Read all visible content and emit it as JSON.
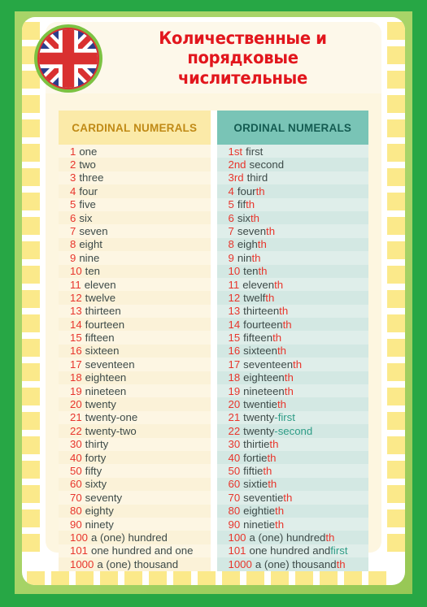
{
  "poster": {
    "title_line1": "Количественные и порядковые",
    "title_line2": "числительные",
    "emblem": "uk-flag-circle"
  },
  "table": {
    "headers": {
      "cardinal": "CARDINAL NUMERALS",
      "ordinal": "ORDINAL NUMERALS"
    },
    "colors": {
      "number_red": "#e8352c",
      "word_dark": "#3d4a48",
      "suffix_red": "#e8352c",
      "suffix_teal": "#2e9c86",
      "cardinal_header_bg": "#fbeaa8",
      "cardinal_header_text": "#c08a16",
      "ordinal_header_bg": "#79c4b6",
      "ordinal_header_text": "#145c52",
      "title_red": "#e2161d",
      "frame_green": "#27a745",
      "frame_light_green": "#a8d468",
      "tile_yellow": "#fbe98a"
    },
    "cardinal": [
      {
        "num": "1",
        "word": "one"
      },
      {
        "num": "2",
        "word": "two"
      },
      {
        "num": "3",
        "word": "three"
      },
      {
        "num": "4",
        "word": "four"
      },
      {
        "num": "5",
        "word": "five"
      },
      {
        "num": "6",
        "word": "six"
      },
      {
        "num": "7",
        "word": "seven"
      },
      {
        "num": "8",
        "word": "eight"
      },
      {
        "num": "9",
        "word": "nine"
      },
      {
        "num": "10",
        "word": "ten"
      },
      {
        "num": "11",
        "word": "eleven"
      },
      {
        "num": "12",
        "word": "twelve"
      },
      {
        "num": "13",
        "word": "thirteen"
      },
      {
        "num": "14",
        "word": "fourteen"
      },
      {
        "num": "15",
        "word": "fifteen"
      },
      {
        "num": "16",
        "word": "sixteen"
      },
      {
        "num": "17",
        "word": "seventeen"
      },
      {
        "num": "18",
        "word": "eighteen"
      },
      {
        "num": "19",
        "word": "nineteen"
      },
      {
        "num": "20",
        "word": "twenty"
      },
      {
        "num": "21",
        "word": "twenty-one"
      },
      {
        "num": "22",
        "word": "twenty-two"
      },
      {
        "num": "30",
        "word": "thirty"
      },
      {
        "num": "40",
        "word": "forty"
      },
      {
        "num": "50",
        "word": "fifty"
      },
      {
        "num": "60",
        "word": "sixty"
      },
      {
        "num": "70",
        "word": "seventy"
      },
      {
        "num": "80",
        "word": "eighty"
      },
      {
        "num": "90",
        "word": "ninety"
      },
      {
        "num": "100",
        "word": "a (one) hundred"
      },
      {
        "num": "101",
        "word": "one hundred and one"
      },
      {
        "num": "1000",
        "word": "a (one) thousand"
      }
    ],
    "ordinal": [
      {
        "num": "1st",
        "stem": "first",
        "suffix": "",
        "suffix_color": "red"
      },
      {
        "num": "2nd",
        "stem": "second",
        "suffix": "",
        "suffix_color": "red"
      },
      {
        "num": "3rd",
        "stem": "third",
        "suffix": "",
        "suffix_color": "red"
      },
      {
        "num": "4",
        "stem": "four",
        "suffix": "th",
        "suffix_color": "red"
      },
      {
        "num": "5",
        "stem": "fif",
        "suffix": "th",
        "suffix_color": "red"
      },
      {
        "num": "6",
        "stem": "six",
        "suffix": "th",
        "suffix_color": "red"
      },
      {
        "num": "7",
        "stem": "seven",
        "suffix": "th",
        "suffix_color": "red"
      },
      {
        "num": "8",
        "stem": "eigh",
        "suffix": "th",
        "suffix_color": "red"
      },
      {
        "num": "9",
        "stem": "nin",
        "suffix": "th",
        "suffix_color": "red"
      },
      {
        "num": "10",
        "stem": "ten",
        "suffix": "th",
        "suffix_color": "red"
      },
      {
        "num": "11",
        "stem": "eleven",
        "suffix": "th",
        "suffix_color": "red"
      },
      {
        "num": "12",
        "stem": "twelf",
        "suffix": "th",
        "suffix_color": "red"
      },
      {
        "num": "13",
        "stem": "thirteen",
        "suffix": "th",
        "suffix_color": "red"
      },
      {
        "num": "14",
        "stem": "fourteen",
        "suffix": "th",
        "suffix_color": "red"
      },
      {
        "num": "15",
        "stem": "fifteen",
        "suffix": "th",
        "suffix_color": "red"
      },
      {
        "num": "16",
        "stem": "sixteen",
        "suffix": "th",
        "suffix_color": "red"
      },
      {
        "num": "17",
        "stem": "seventeen",
        "suffix": "th",
        "suffix_color": "red"
      },
      {
        "num": "18",
        "stem": "eighteen",
        "suffix": "th",
        "suffix_color": "red"
      },
      {
        "num": "19",
        "stem": "nineteen",
        "suffix": "th",
        "suffix_color": "red"
      },
      {
        "num": "20",
        "stem": "twentie",
        "suffix": "th",
        "suffix_color": "red"
      },
      {
        "num": "21",
        "stem": "twenty",
        "suffix": "-first",
        "suffix_color": "teal"
      },
      {
        "num": "22",
        "stem": "twenty",
        "suffix": "-second",
        "suffix_color": "teal"
      },
      {
        "num": "30",
        "stem": "thirtie",
        "suffix": "th",
        "suffix_color": "red"
      },
      {
        "num": "40",
        "stem": "fortie",
        "suffix": "th",
        "suffix_color": "red"
      },
      {
        "num": "50",
        "stem": "fiftie",
        "suffix": "th",
        "suffix_color": "red"
      },
      {
        "num": "60",
        "stem": "sixtie",
        "suffix": "th",
        "suffix_color": "red"
      },
      {
        "num": "70",
        "stem": "seventie",
        "suffix": "th",
        "suffix_color": "red"
      },
      {
        "num": "80",
        "stem": "eightie",
        "suffix": "th",
        "suffix_color": "red"
      },
      {
        "num": "90",
        "stem": "ninetie",
        "suffix": "th",
        "suffix_color": "red"
      },
      {
        "num": "100",
        "stem": "a (one) hundred",
        "suffix": "th",
        "suffix_color": "red"
      },
      {
        "num": "101",
        "stem": "one hundred and ",
        "suffix": "first",
        "suffix_color": "teal"
      },
      {
        "num": "1000",
        "stem": "a (one) thousand",
        "suffix": "th",
        "suffix_color": "red"
      }
    ]
  }
}
